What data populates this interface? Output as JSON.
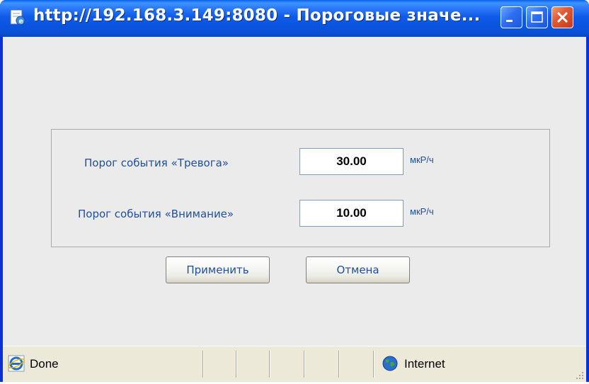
{
  "window": {
    "title": "http://192.168.3.149:8080 - Пороговые значе..."
  },
  "form": {
    "alarm_label": "Порог события «Тревога»",
    "alarm_value": "30.00",
    "alarm_unit": "мкР/ч",
    "warning_label": "Порог события «Внимание»",
    "warning_value": "10.00",
    "warning_unit": "мкР/ч"
  },
  "buttons": {
    "apply": "Применить",
    "cancel": "Отмена"
  },
  "statusbar": {
    "status": "Done",
    "zone": "Internet"
  },
  "icons": {
    "title": "ie-page-icon",
    "minimize": "minimize-icon",
    "maximize": "maximize-icon",
    "close": "close-icon",
    "status": "ie-logo-icon",
    "zone": "globe-icon"
  },
  "colors": {
    "titlebar": "#0a54e0",
    "label_text": "#1f4e9c",
    "client_bg": "#ebebeb",
    "close_button": "#de5a36"
  }
}
